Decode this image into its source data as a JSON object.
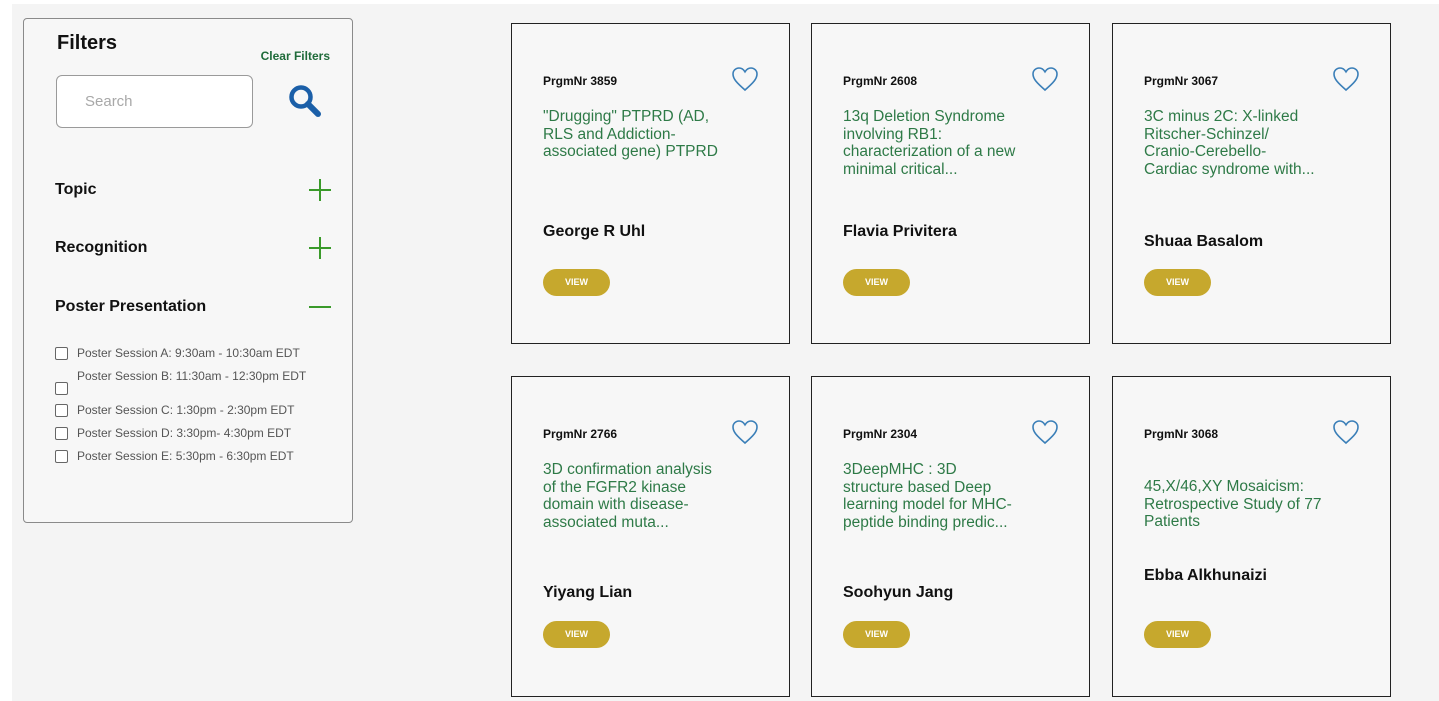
{
  "filters": {
    "title": "Filters",
    "clear_label": "Clear Filters",
    "search_placeholder": "Search",
    "search_value": "",
    "facets": [
      {
        "label": "Topic",
        "state": "collapsed"
      },
      {
        "label": "Recognition",
        "state": "collapsed"
      },
      {
        "label": "Poster Presentation",
        "state": "expanded"
      }
    ],
    "poster_sessions": [
      {
        "label": "Poster Session A: 9:30am - 10:30am EDT",
        "checked": false
      },
      {
        "label": "Poster Session B: 11:30am - 12:30pm EDT",
        "checked": false
      },
      {
        "label": "Poster Session C: 1:30pm - 2:30pm EDT",
        "checked": false
      },
      {
        "label": "Poster Session D: 3:30pm- 4:30pm EDT",
        "checked": false
      },
      {
        "label": "Poster Session E: 5:30pm - 6:30pm EDT",
        "checked": false
      }
    ],
    "icons": {
      "search": "search-icon",
      "expand": "plus-icon",
      "collapse": "minus-icon"
    }
  },
  "cards": [
    {
      "prgm": "PrgmNr 3859",
      "title": "\"Drugging\" PTPRD (AD, RLS and Addiction-associated gene) PTPRD",
      "author": "George R Uhl",
      "view_label": "VIEW"
    },
    {
      "prgm": "PrgmNr 2608",
      "title": "13q Deletion Syndrome involving RB1: characterization of a new minimal critical...",
      "author": "Flavia Privitera",
      "view_label": "VIEW"
    },
    {
      "prgm": "PrgmNr 3067",
      "title": "3C minus 2C: X-linked Ritscher-Schinzel/ Cranio-Cerebello-Cardiac syndrome with...",
      "author": "Shuaa Basalom",
      "view_label": "VIEW"
    },
    {
      "prgm": "PrgmNr 2766",
      "title": "3D confirmation analysis of the FGFR2 kinase domain with disease-associated muta...",
      "author": "Yiyang Lian",
      "view_label": "VIEW"
    },
    {
      "prgm": "PrgmNr 2304",
      "title": "3DeepMHC : 3D structure based Deep learning model for MHC-peptide binding predic...",
      "author": "Soohyun Jang",
      "view_label": "VIEW"
    },
    {
      "prgm": "PrgmNr 3068",
      "title": "45,X/46,XY Mosaicism: Retrospective Study of 77 Patients",
      "author": "Ebba Alkhunaizi",
      "view_label": "VIEW"
    }
  ],
  "colors": {
    "accent_green": "#3a9a2a",
    "title_green": "#2e7a47",
    "search_blue": "#1b5fa8",
    "heart_blue": "#3b7fb8",
    "view_gold": "#c6a82d"
  }
}
